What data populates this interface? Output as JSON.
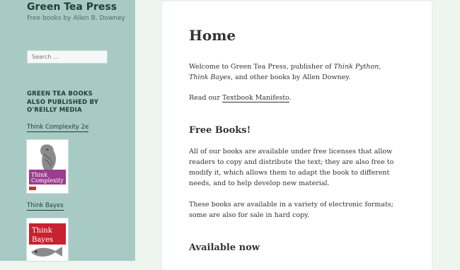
{
  "sidebar": {
    "site_title": "Green Tea Press",
    "site_description": "Free books by Allen B. Downey",
    "search_placeholder": "Search …",
    "widget_title": "GREEN TEA BOOKS ALSO PUBLISHED BY O'REILLY MEDIA",
    "books": [
      {
        "label": "Think Complexity 2e",
        "cover_text": "Think Complexity"
      },
      {
        "label": "Think Bayes",
        "cover_text": "Think Bayes"
      }
    ],
    "colors": {
      "sidebar_bg": "#a8cac4",
      "title": "#1f3d33"
    }
  },
  "main": {
    "title": "Home",
    "intro": {
      "before": "Welcome to Green Tea Press, publisher of ",
      "book1": "Think Python",
      "sep": ", ",
      "book2": "Think Bayes",
      "after": ", and other books by Allen Downey."
    },
    "manifesto": {
      "before": "Read our ",
      "link": "Textbook Manifesto",
      "after": "."
    },
    "free_books_heading": "Free Books!",
    "free_books_p1": "All of our books are available under free licenses that allow readers to copy and distribute the text; they are also free to modify it, which allows them to adapt the book to different needs, and to help develop new material.",
    "free_books_p2": "These books are available in a variety of electronic formats; some are also for sale in hard copy.",
    "available_heading": "Available now"
  }
}
